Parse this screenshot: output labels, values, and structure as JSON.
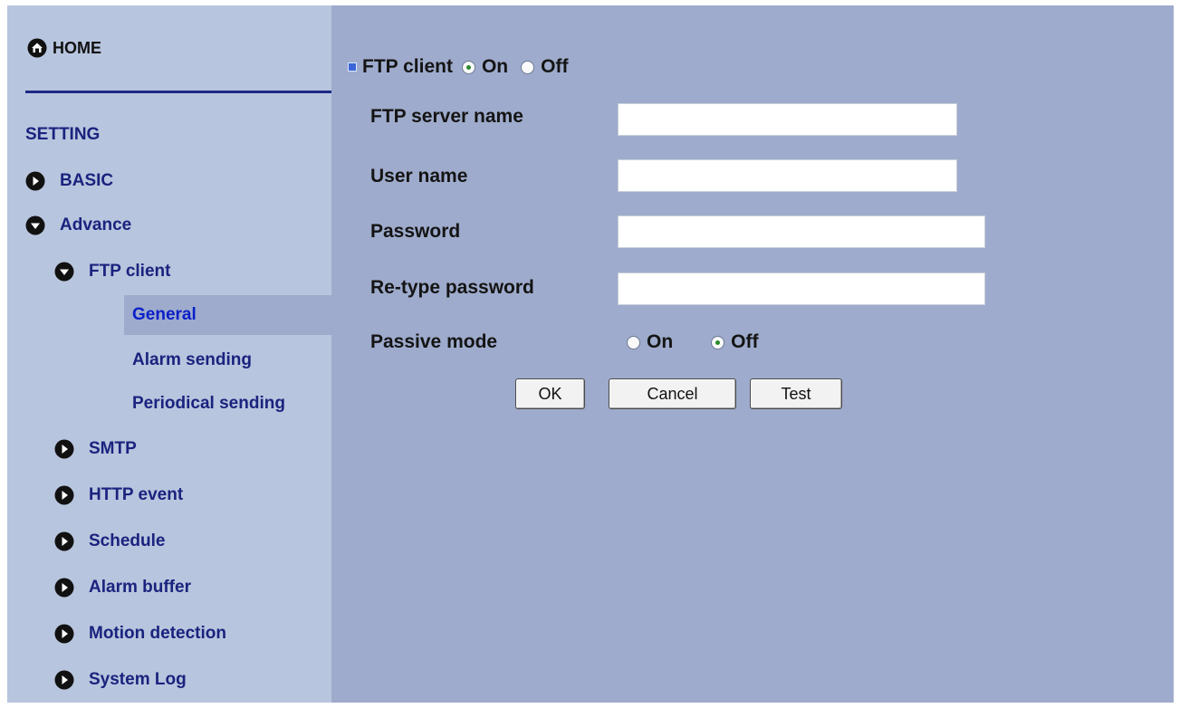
{
  "sidebar": {
    "home_label": "HOME",
    "setting_label": "SETTING",
    "items": [
      {
        "label": "BASIC",
        "icon": "arrow-right-icon"
      },
      {
        "label": "Advance",
        "icon": "arrow-down-icon"
      },
      {
        "label": "FTP client",
        "icon": "arrow-down-icon"
      },
      {
        "label": "SMTP",
        "icon": "arrow-right-icon"
      },
      {
        "label": "HTTP event",
        "icon": "arrow-right-icon"
      },
      {
        "label": "Schedule",
        "icon": "arrow-right-icon"
      },
      {
        "label": "Alarm buffer",
        "icon": "arrow-right-icon"
      },
      {
        "label": "Motion detection",
        "icon": "arrow-right-icon"
      },
      {
        "label": "System Log",
        "icon": "arrow-right-icon"
      }
    ],
    "sub_items": [
      {
        "label": "General",
        "active": true
      },
      {
        "label": "Alarm sending",
        "active": false
      },
      {
        "label": "Periodical sending",
        "active": false
      }
    ]
  },
  "main": {
    "title": "FTP client",
    "enable_on_label": "On",
    "enable_off_label": "Off",
    "enable_value": "On",
    "fields": {
      "server_label": "FTP server name",
      "server_value": "",
      "user_label": "User name",
      "user_value": "",
      "password_label": "Password",
      "password_value": "",
      "retype_label": "Re-type password",
      "retype_value": ""
    },
    "passive": {
      "label": "Passive mode",
      "on_label": "On",
      "off_label": "Off",
      "value": "Off"
    },
    "buttons": {
      "ok": "OK",
      "cancel": "Cancel",
      "test": "Test"
    }
  },
  "colors": {
    "sidebar_bg": "#b8c5de",
    "main_bg": "#9eabcc",
    "nav_text": "#1a237e",
    "active_text": "#0a1fc8"
  }
}
